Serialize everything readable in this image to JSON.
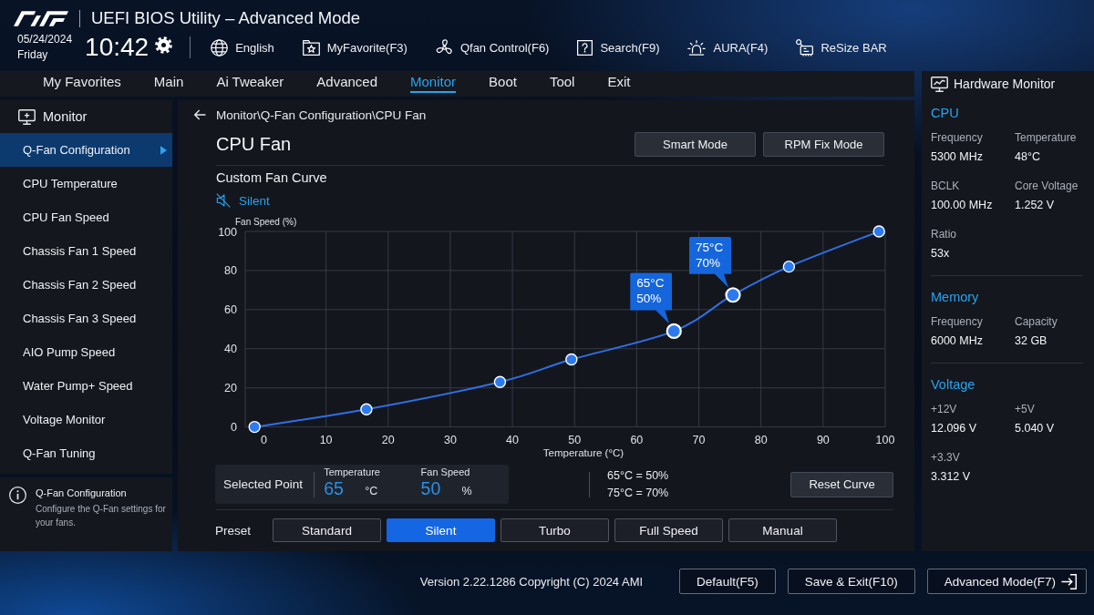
{
  "header": {
    "title": "UEFI BIOS Utility – Advanced Mode",
    "date": "05/24/2024",
    "weekday": "Friday",
    "time": "10:42",
    "tools": [
      {
        "kind": "language",
        "label": "English"
      },
      {
        "kind": "favorite",
        "label": "MyFavorite(F3)"
      },
      {
        "kind": "fan",
        "label": "Qfan Control(F6)"
      },
      {
        "kind": "search",
        "label": "Search(F9)"
      },
      {
        "kind": "aura",
        "label": "AURA(F4)"
      },
      {
        "kind": "resize",
        "label": "ReSize BAR"
      }
    ]
  },
  "tabs": [
    {
      "label": "My Favorites",
      "selected": false
    },
    {
      "label": "Main",
      "selected": false
    },
    {
      "label": "Ai Tweaker",
      "selected": false
    },
    {
      "label": "Advanced",
      "selected": false
    },
    {
      "label": "Monitor",
      "selected": true
    },
    {
      "label": "Boot",
      "selected": false
    },
    {
      "label": "Tool",
      "selected": false
    },
    {
      "label": "Exit",
      "selected": false
    }
  ],
  "sidebar": {
    "title": "Monitor",
    "items": [
      {
        "label": "Q-Fan Configuration",
        "selected": true
      },
      {
        "label": "CPU Temperature",
        "selected": false
      },
      {
        "label": "CPU Fan Speed",
        "selected": false
      },
      {
        "label": "Chassis Fan 1 Speed",
        "selected": false
      },
      {
        "label": "Chassis Fan 2 Speed",
        "selected": false
      },
      {
        "label": "Chassis Fan 3 Speed",
        "selected": false
      },
      {
        "label": "AIO Pump Speed",
        "selected": false
      },
      {
        "label": "Water Pump+ Speed",
        "selected": false
      },
      {
        "label": "Voltage Monitor",
        "selected": false
      },
      {
        "label": "Q-Fan Tuning",
        "selected": false
      }
    ],
    "help": {
      "title": "Q-Fan Configuration",
      "text": "Configure the Q-Fan settings for your fans."
    }
  },
  "main": {
    "breadcrumb": "Monitor\\Q-Fan Configuration\\CPU Fan",
    "title": "CPU Fan",
    "modes": [
      "Smart Mode",
      "RPM Fix Mode"
    ],
    "section_title": "Custom Fan Curve",
    "profile": "Silent",
    "chart_data": {
      "type": "line",
      "xlabel": "Temperature (°C)",
      "ylabel": "Fan Speed (%)",
      "x": [
        -1.5,
        16.5,
        38,
        49.5,
        66,
        75.5,
        84.5,
        99
      ],
      "values": [
        0,
        9,
        23,
        34.5,
        49,
        67.5,
        82,
        100
      ],
      "xlim": [
        -3,
        100
      ],
      "ylim": [
        0,
        100
      ],
      "xticks": [
        0,
        10,
        20,
        30,
        40,
        50,
        60,
        70,
        80,
        90,
        100
      ],
      "yticks": [
        0,
        20,
        40,
        60,
        80,
        100
      ],
      "grid": true,
      "marker": "circle",
      "annotations": [
        {
          "x": 66,
          "y": 49,
          "text": "65°C 50%"
        },
        {
          "x": 75.5,
          "y": 67.5,
          "text": "75°C 70%"
        }
      ]
    },
    "selected_point": {
      "label": "Selected Point",
      "temperature_label": "Temperature",
      "temperature": "65",
      "temperature_unit": "°C",
      "speed_label": "Fan Speed",
      "speed": "50",
      "speed_unit": "%"
    },
    "point_summary": [
      "65°C = 50%",
      "75°C = 70%"
    ],
    "reset_button": "Reset Curve",
    "preset_label": "Preset",
    "presets": [
      {
        "label": "Standard",
        "selected": false
      },
      {
        "label": "Silent",
        "selected": true
      },
      {
        "label": "Turbo",
        "selected": false
      },
      {
        "label": "Full Speed",
        "selected": false
      },
      {
        "label": "Manual",
        "selected": false
      }
    ]
  },
  "hardware_monitor": {
    "title": "Hardware Monitor",
    "sections": [
      {
        "title": "CPU",
        "items": [
          {
            "label": "Frequency",
            "value": "5300 MHz"
          },
          {
            "label": "Temperature",
            "value": "48°C"
          },
          {
            "label": "BCLK",
            "value": "100.00 MHz"
          },
          {
            "label": "Core Voltage",
            "value": "1.252 V"
          },
          {
            "label": "Ratio",
            "value": "53x"
          }
        ]
      },
      {
        "title": "Memory",
        "items": [
          {
            "label": "Frequency",
            "value": "6000 MHz"
          },
          {
            "label": "Capacity",
            "value": "32 GB"
          }
        ]
      },
      {
        "title": "Voltage",
        "items": [
          {
            "label": "+12V",
            "value": "12.096 V"
          },
          {
            "label": "+5V",
            "value": "5.040 V"
          },
          {
            "label": "+3.3V",
            "value": "3.312 V"
          }
        ]
      }
    ]
  },
  "footer": {
    "version": "Version 2.22.1286 Copyright (C) 2024 AMI",
    "buttons": [
      {
        "kind": "plain",
        "label": "Default(F5)"
      },
      {
        "kind": "plain",
        "label": "Save & Exit(F10)"
      },
      {
        "kind": "exit",
        "label": "Advanced Mode(F7)"
      }
    ]
  }
}
